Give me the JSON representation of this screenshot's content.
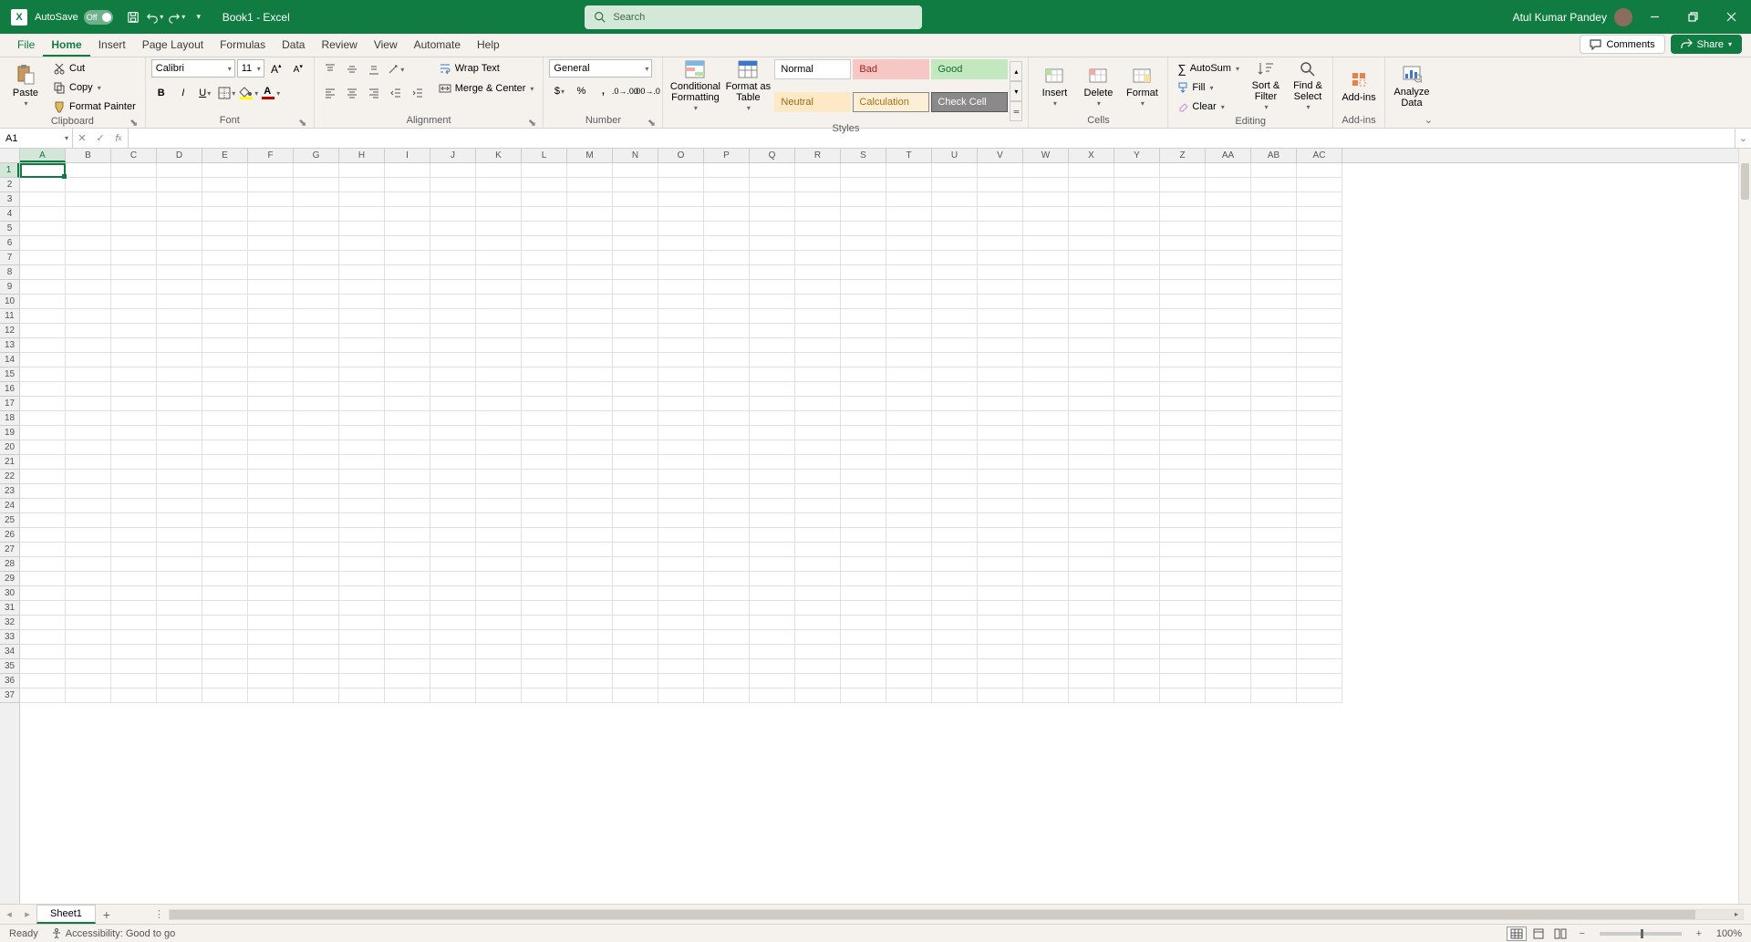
{
  "titlebar": {
    "autosave_label": "AutoSave",
    "autosave_state": "Off",
    "doc_title": "Book1  -  Excel",
    "search_placeholder": "Search",
    "user_name": "Atul Kumar Pandey"
  },
  "tabs": {
    "items": [
      "File",
      "Home",
      "Insert",
      "Page Layout",
      "Formulas",
      "Data",
      "Review",
      "View",
      "Automate",
      "Help"
    ],
    "active_index": 1,
    "comments_label": "Comments",
    "share_label": "Share"
  },
  "ribbon": {
    "clipboard": {
      "label": "Clipboard",
      "paste": "Paste",
      "cut": "Cut",
      "copy": "Copy",
      "format_painter": "Format Painter"
    },
    "font": {
      "label": "Font",
      "name": "Calibri",
      "size": "11"
    },
    "alignment": {
      "label": "Alignment",
      "wrap": "Wrap Text",
      "merge": "Merge & Center"
    },
    "number": {
      "label": "Number",
      "format": "General"
    },
    "styles": {
      "label": "Styles",
      "cond_fmt": "Conditional Formatting",
      "fmt_table": "Format as Table",
      "cells": [
        "Normal",
        "Bad",
        "Good",
        "Neutral",
        "Calculation",
        "Check Cell"
      ]
    },
    "cells_grp": {
      "label": "Cells",
      "insert": "Insert",
      "delete": "Delete",
      "format": "Format"
    },
    "editing": {
      "label": "Editing",
      "autosum": "AutoSum",
      "fill": "Fill",
      "clear": "Clear",
      "sort": "Sort & Filter",
      "find": "Find & Select"
    },
    "addins": {
      "label": "Add-ins",
      "btn": "Add-ins"
    },
    "analyze": {
      "btn": "Analyze Data"
    }
  },
  "formula_bar": {
    "name_box": "A1",
    "formula": ""
  },
  "grid": {
    "columns": [
      "A",
      "B",
      "C",
      "D",
      "E",
      "F",
      "G",
      "H",
      "I",
      "J",
      "K",
      "L",
      "M",
      "N",
      "O",
      "P",
      "Q",
      "R",
      "S",
      "T",
      "U",
      "V",
      "W",
      "X",
      "Y",
      "Z",
      "AA",
      "AB",
      "AC"
    ],
    "row_count": 37,
    "selected_cell": "A1",
    "selected_col_index": 0,
    "selected_row_index": 0
  },
  "sheettabs": {
    "active": "Sheet1"
  },
  "status": {
    "ready": "Ready",
    "accessibility": "Accessibility: Good to go",
    "zoom": "100%"
  },
  "colors": {
    "brand": "#107c41",
    "fill_accent": "#ffff00",
    "font_accent": "#c00000"
  },
  "style_swatches": {
    "Normal": {
      "bg": "#ffffff",
      "fg": "#000",
      "border": "#ccc"
    },
    "Bad": {
      "bg": "#f6c7c4",
      "fg": "#a6201f",
      "border": "#f6c7c4"
    },
    "Good": {
      "bg": "#c3e8c0",
      "fg": "#0f6d2f",
      "border": "#c3e8c0"
    },
    "Neutral": {
      "bg": "#fde9c6",
      "fg": "#9a6b17",
      "border": "#fde9c6"
    },
    "Calculation": {
      "bg": "#fcefd6",
      "fg": "#b46d0d",
      "border": "#888"
    },
    "Check Cell": {
      "bg": "#8a8a8a",
      "fg": "#fff",
      "border": "#555"
    }
  }
}
